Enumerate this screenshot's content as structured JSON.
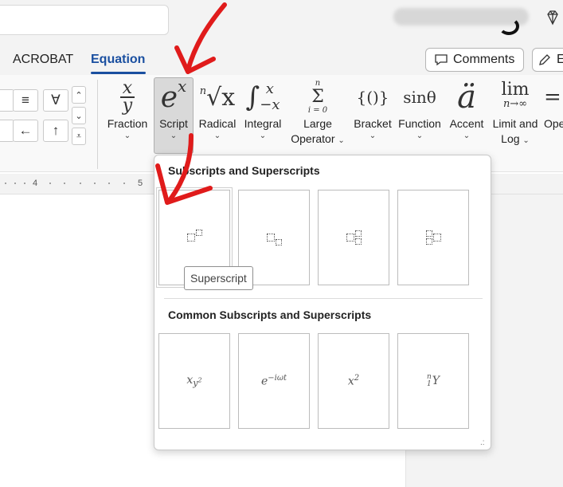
{
  "tabs": {
    "acrobat": "ACROBAT",
    "equation": "Equation"
  },
  "header_buttons": {
    "comments": "Comments",
    "edit": "E"
  },
  "symbols": {
    "row1": [
      "",
      "≡",
      "∀"
    ],
    "row2": [
      "",
      "←",
      "↑"
    ]
  },
  "ribbon_groups": [
    {
      "id": "fraction",
      "label1": "Fraction",
      "label2": ""
    },
    {
      "id": "script",
      "label1": "Script",
      "label2": ""
    },
    {
      "id": "radical",
      "label1": "Radical",
      "label2": ""
    },
    {
      "id": "integral",
      "label1": "Integral",
      "label2": ""
    },
    {
      "id": "large-operator",
      "label1": "Large",
      "label2": "Operator"
    },
    {
      "id": "bracket",
      "label1": "Bracket",
      "label2": ""
    },
    {
      "id": "function",
      "label1": "Function",
      "label2": ""
    },
    {
      "id": "accent",
      "label1": "Accent",
      "label2": ""
    },
    {
      "id": "limit-log",
      "label1": "Limit and",
      "label2": "Log"
    },
    {
      "id": "operator",
      "label1": "Ope",
      "label2": ""
    }
  ],
  "ribbon_glyphs": {
    "script_base": "e",
    "script_sup": "x",
    "radical": "√x",
    "radical_index": "n",
    "integral": "∫",
    "integral_up": "x",
    "integral_low": "−x",
    "large_op": "Σ",
    "large_op_top": "n",
    "large_op_bottom": "i = 0",
    "bracket": "{()}",
    "function": "sinθ",
    "accent": "ä",
    "limit": "lim",
    "limit_sub": "n→∞",
    "fraction_num": "x",
    "fraction_den": "y"
  },
  "ruler": {
    "labels": [
      "4",
      "5"
    ]
  },
  "panel": {
    "section1_title": "Subscripts and Superscripts",
    "section2_title": "Common Subscripts and Superscripts",
    "tooltip": "Superscript",
    "common": {
      "t1_base": "x",
      "t1_sub": "y",
      "t1_subsup": "2",
      "t2_base": "e",
      "t2_sup": "−iωt",
      "t3_base": "x",
      "t3_sup": "2",
      "t4_pre_sup": "n",
      "t4_pre_sub": "1",
      "t4_base": "Y"
    }
  },
  "colors": {
    "accent_blue": "#1a4fa0",
    "annotation_red": "#e01b1b"
  }
}
